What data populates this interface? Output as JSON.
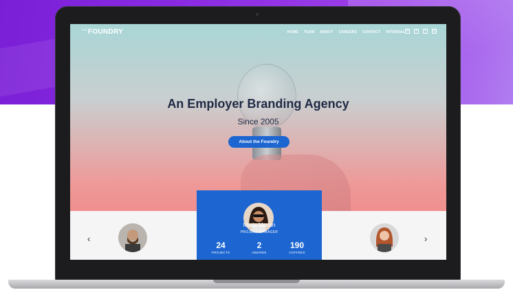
{
  "brand": {
    "logo_prefix": "THE",
    "logo": "FOUNDRY"
  },
  "nav": [
    "HOME",
    "TEAM",
    "ABOUT",
    "CAREERS",
    "CONTACT",
    "INTERNAL"
  ],
  "social": [
    "linkedin-icon",
    "twitter-icon",
    "facebook-icon",
    "instagram-icon"
  ],
  "hero": {
    "headline": "An Employer Branding Agency",
    "subheadline": "Since 2005",
    "cta": "About the Foundry"
  },
  "team": {
    "prev_arrow": "‹",
    "next_arrow": "›",
    "featured": {
      "name": "Maria Merian",
      "role": "PROJECT MANAGER",
      "stats": [
        {
          "value": "24",
          "label": "PROJECTS"
        },
        {
          "value": "2",
          "label": "AWARDS"
        },
        {
          "value": "190",
          "label": "COFFEES"
        }
      ]
    }
  },
  "colors": {
    "accent": "#1d66d1",
    "headline": "#1f2a44",
    "purple": "#8a2be2"
  }
}
